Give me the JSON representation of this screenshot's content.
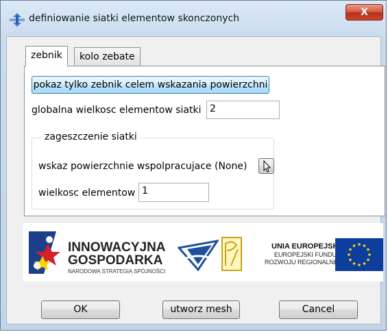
{
  "window": {
    "title": "definiowanie siatki elementow skonczonych",
    "close_label": "X"
  },
  "tabs": [
    {
      "label": "zebnik",
      "active": true
    },
    {
      "label": "kolo zebate",
      "active": false
    }
  ],
  "panel": {
    "show_button_label": "pokaz tylko zebnik celem wskazania powierzchni",
    "global_size_label": "globalna wielkosc elementow siatki",
    "global_size_value": "2",
    "group": {
      "title": "zageszczenie siatki",
      "surface_label": "wskaz powierzchnie wspolpracujace (None)",
      "element_size_label": "wielkosc elementow",
      "element_size_value": "1"
    }
  },
  "logos": {
    "ig_line1": "INNOWACYJNA",
    "ig_line2": "GOSPODARKA",
    "ig_line3": "NARODOWA STRATEGIA SPÓJNOŚCI",
    "eu_line1": "UNIA EUROPEJSKA",
    "eu_line2": "EUROPEJSKI FUNDUSZ",
    "eu_line3": "ROZWOJU REGIONALNEGO"
  },
  "buttons": {
    "ok": "OK",
    "mesh": "utworz mesh",
    "cancel": "Cancel"
  },
  "colors": {
    "eu_blue": "#0d3e9e",
    "eu_star": "#ffd200",
    "ig_blue": "#1b3f8b",
    "ig_red": "#d3202b"
  }
}
